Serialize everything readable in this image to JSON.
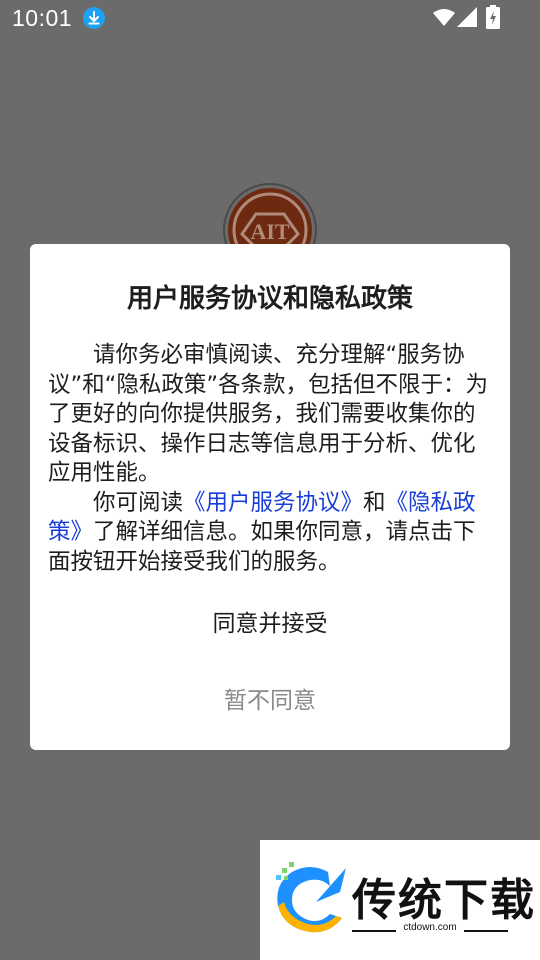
{
  "status_bar": {
    "time": "10:01",
    "icons": [
      "download-icon",
      "wifi-icon",
      "signal-icon",
      "battery-icon"
    ]
  },
  "app_logo": {
    "icon": "app-logo-icon",
    "text": "AIT"
  },
  "dialog": {
    "title": "用户服务协议和隐私政策",
    "paragraph1": "请你务必审慎阅读、充分理解“服务协议”和“隐私政策”各条款，包括但不限于：为了更好的向你提供服务，我们需要收集你的设备标识、操作日志等信息用于分析、优化应用性能。",
    "paragraph2_prefix": "你可阅读",
    "link_user_agreement": "《用户服务协议》",
    "conjunction": "和",
    "link_privacy_policy": "《隐私政策》",
    "paragraph2_suffix": "了解详细信息。如果你同意，请点击下面按钮开始接受我们的服务。",
    "accept_label": "同意并接受",
    "decline_label": "暂不同意"
  },
  "watermark": {
    "title": "传统下载",
    "url": "ctdown.com"
  },
  "colors": {
    "overlay": "#6b6b6b",
    "link": "#1a3fd6",
    "decline_text": "#8a8a8a",
    "logo_brown": "#8b2e0c"
  }
}
